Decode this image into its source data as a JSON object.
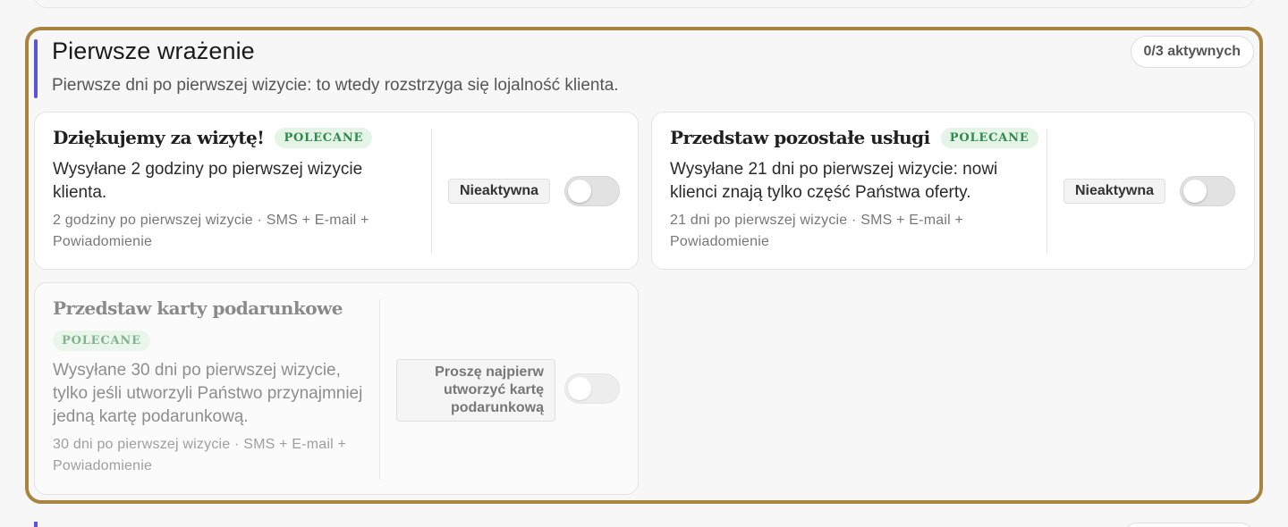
{
  "section": {
    "title": "Pierwsze wrażenie",
    "description": "Pierwsze dni po pierwszej wizycie: to wtedy rozstrzyga się lojalność klienta.",
    "active_count": "0/3 aktywnych",
    "accent_color": "#5b55d6",
    "highlight_color": "#a8843e"
  },
  "cards": [
    {
      "title": "Dziękujemy za wizytę!",
      "badge": "POLECANE",
      "description": "Wysyłane 2 godziny po pierwszej wizycie klienta.",
      "meta": "2 godziny po pierwszej wizycie · SMS + E-mail + Powiadomienie",
      "status": "Nieaktywna",
      "enabled": false
    },
    {
      "title": "Przedstaw pozostałe usługi",
      "badge": "POLECANE",
      "description": "Wysyłane 21 dni po pierwszej wizycie: nowi klienci znają tylko część Państwa oferty.",
      "meta": "21 dni po pierwszej wizycie · SMS + E-mail + Powiadomienie",
      "status": "Nieaktywna",
      "enabled": false
    },
    {
      "title": "Przedstaw karty podarunkowe",
      "badge": "POLECANE",
      "description": "Wysyłane 30 dni po pierwszej wizycie, tylko jeśli utworzyli Państwo przynajmniej jedną kartę podarunkową.",
      "meta": "30 dni po pierwszej wizycie · SMS + E-mail + Powiadomienie",
      "status": "Proszę najpierw utworzyć kartę podarunkową",
      "enabled": false,
      "disabled": true
    }
  ]
}
